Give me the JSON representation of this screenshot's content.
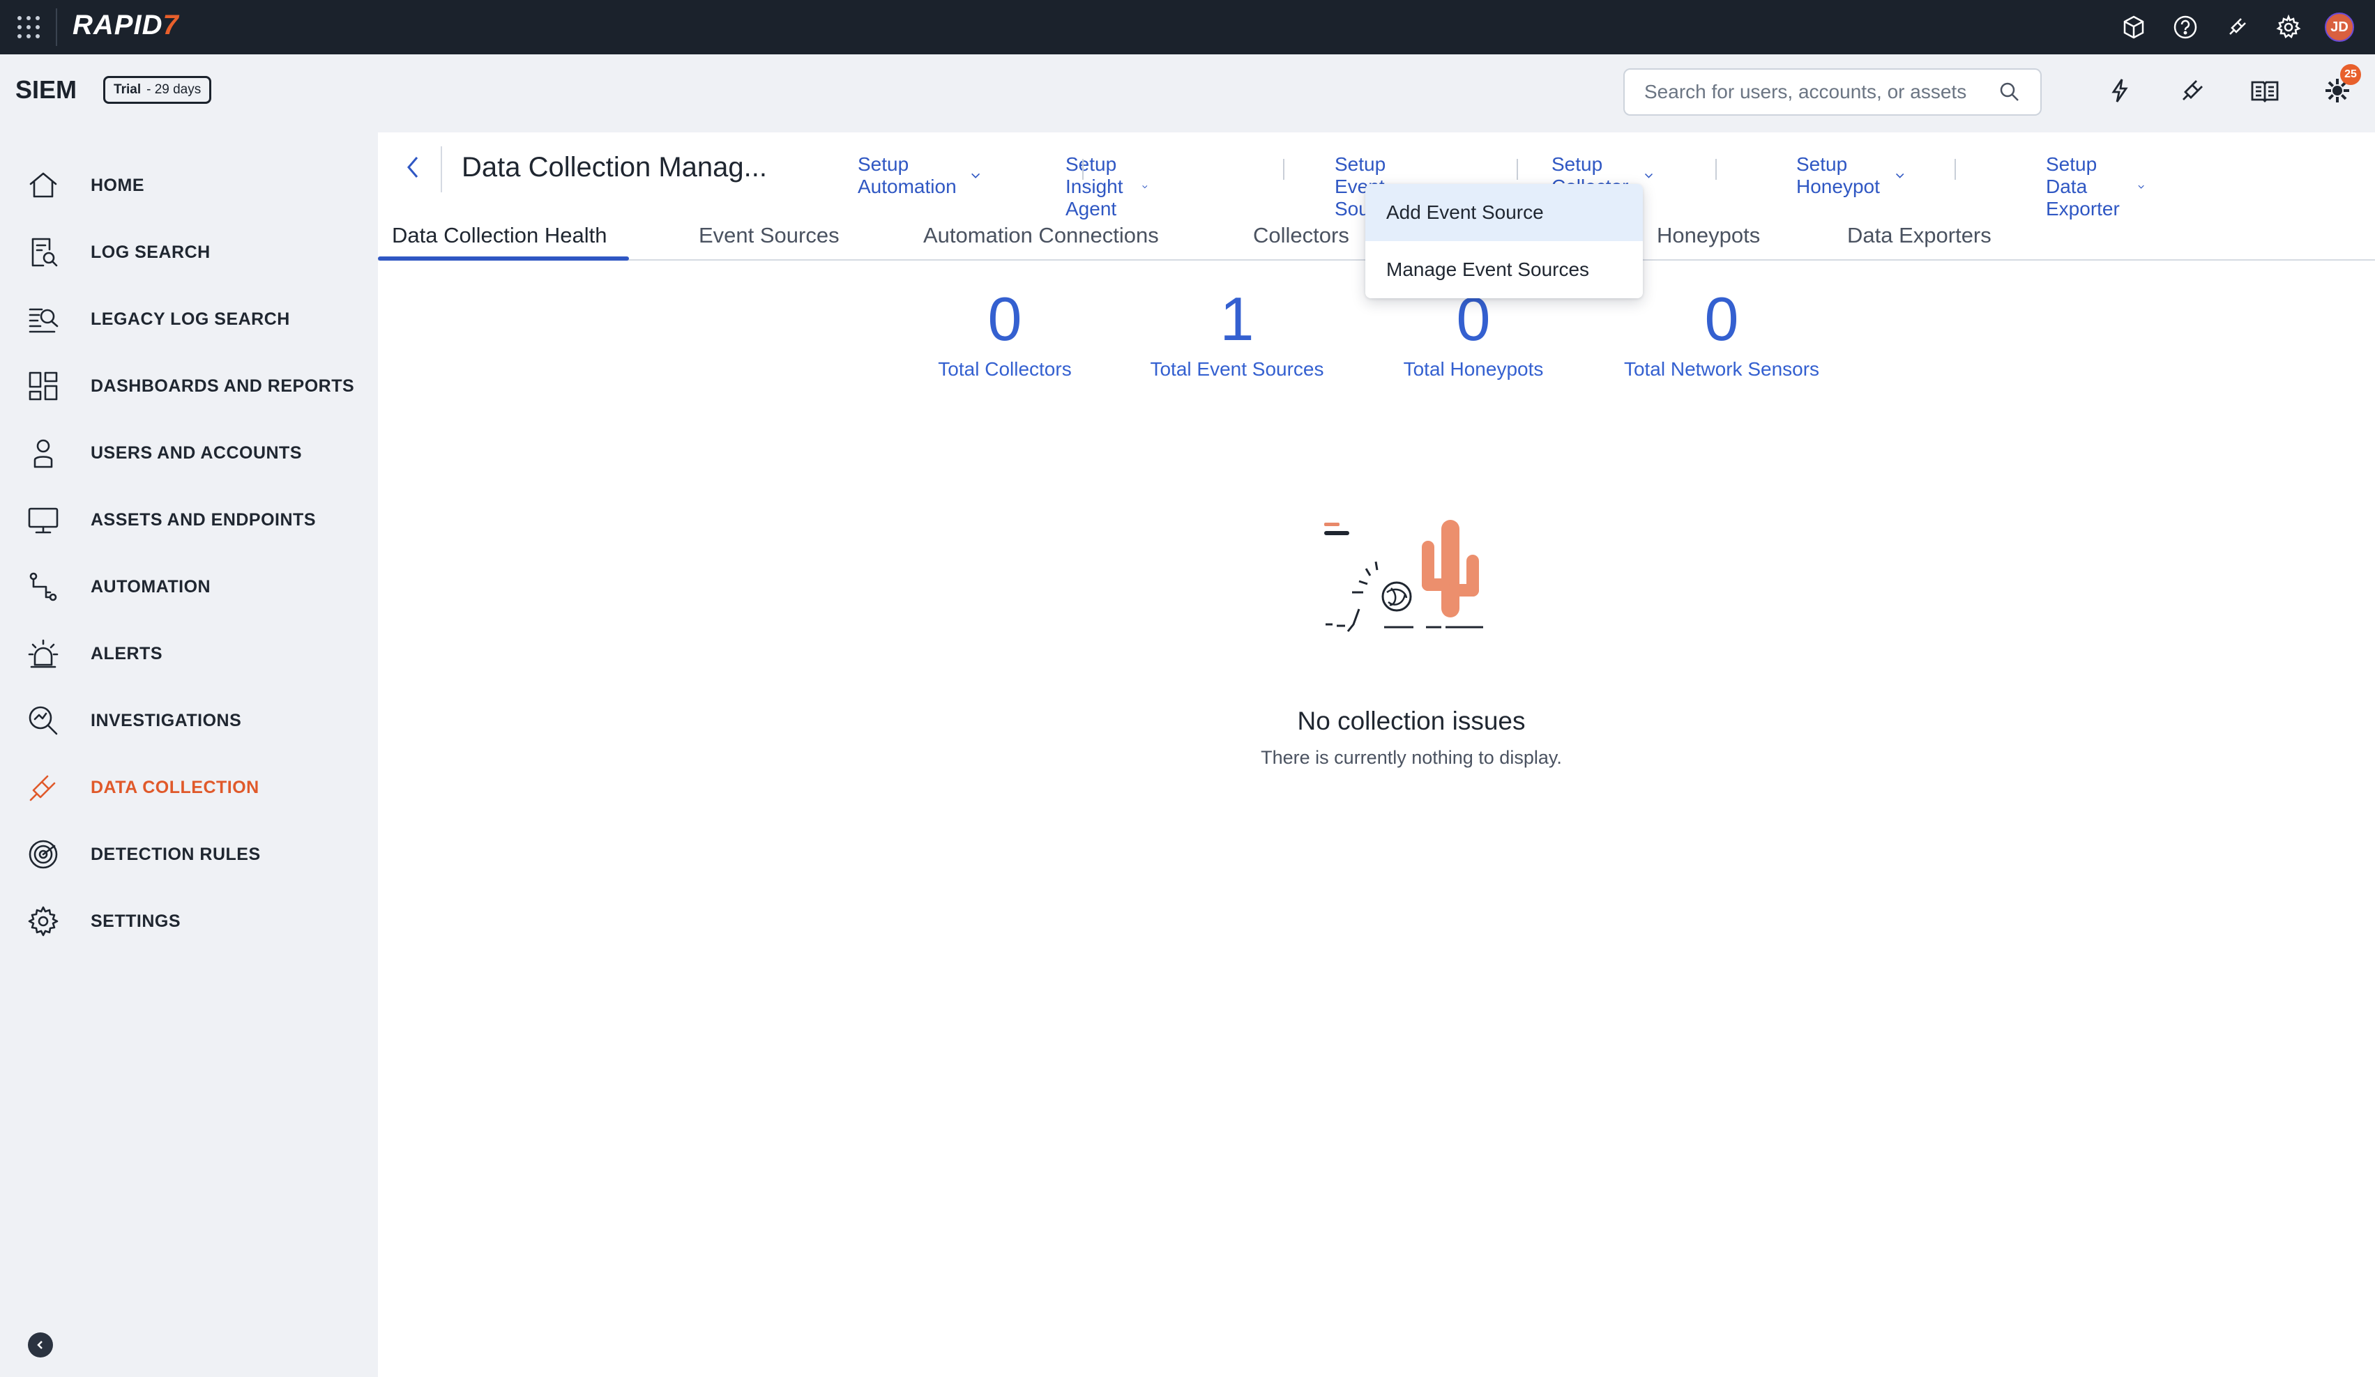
{
  "brand": {
    "name_main": "RAPID",
    "name_accent": "7"
  },
  "app": {
    "name": "SIEM",
    "trial_label": "Trial",
    "trial_days": "- 29 days"
  },
  "search": {
    "placeholder": "Search for users, accounts, or assets"
  },
  "notifications": {
    "count": "25"
  },
  "user": {
    "initials": "JD"
  },
  "sidebar": {
    "items": [
      {
        "label": "HOME",
        "icon": "home-icon"
      },
      {
        "label": "LOG SEARCH",
        "icon": "log-search-icon"
      },
      {
        "label": "LEGACY LOG SEARCH",
        "icon": "legacy-log-search-icon"
      },
      {
        "label": "DASHBOARDS AND REPORTS",
        "icon": "dashboard-icon"
      },
      {
        "label": "USERS AND ACCOUNTS",
        "icon": "user-icon"
      },
      {
        "label": "ASSETS AND ENDPOINTS",
        "icon": "monitor-icon"
      },
      {
        "label": "AUTOMATION",
        "icon": "automation-icon"
      },
      {
        "label": "ALERTS",
        "icon": "alarm-icon"
      },
      {
        "label": "INVESTIGATIONS",
        "icon": "investigation-icon"
      },
      {
        "label": "DATA COLLECTION",
        "icon": "plug-icon",
        "active": true
      },
      {
        "label": "DETECTION RULES",
        "icon": "radar-icon"
      },
      {
        "label": "SETTINGS",
        "icon": "gear-icon"
      }
    ]
  },
  "page": {
    "title": "Data Collection Manag..."
  },
  "setup_links": [
    "Setup Automation",
    "Setup Insight Agent",
    "Setup Event Source",
    "Setup Collector",
    "Setup Honeypot",
    "Setup Data Exporter"
  ],
  "tabs": [
    "Data Collection Health",
    "Event Sources",
    "Automation Connections",
    "Collectors",
    "Honeypots",
    "Data Exporters"
  ],
  "stats": [
    {
      "value": "0",
      "label": "Total Collectors"
    },
    {
      "value": "1",
      "label": "Total Event Sources"
    },
    {
      "value": "0",
      "label": "Total Honeypots"
    },
    {
      "value": "0",
      "label": "Total Network Sensors"
    }
  ],
  "empty_state": {
    "title": "No collection issues",
    "subtitle": "There is currently nothing to display."
  },
  "dropdown": {
    "items": [
      "Add Event Source",
      "Manage Event Sources"
    ]
  },
  "colors": {
    "accent": "#e8602c",
    "link": "#2f57c3",
    "stat": "#3460d0",
    "topbar": "#1b222c"
  }
}
